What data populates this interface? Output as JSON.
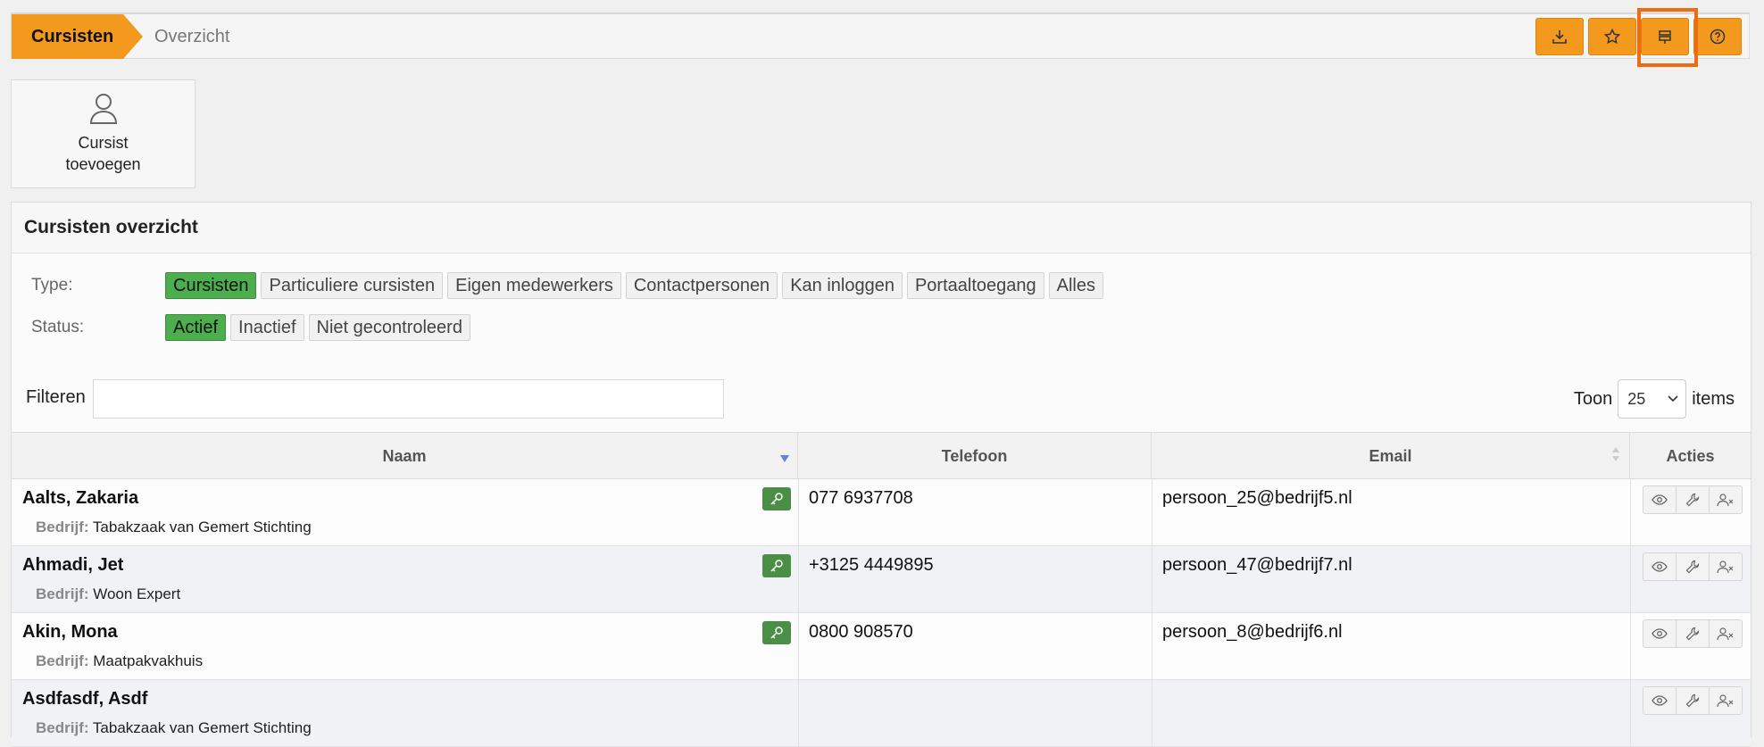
{
  "breadcrumb": {
    "main": "Cursisten",
    "sub": "Overzicht"
  },
  "toolbar": {
    "buttons": [
      "download-icon",
      "star-icon",
      "layout-icon",
      "help-icon"
    ],
    "accent": "#f39a1e",
    "highlight_color": "#f06a0f"
  },
  "add_button": {
    "line1": "Cursist",
    "line2": "toevoegen"
  },
  "panel": {
    "title": "Cursisten overzicht",
    "type_label": "Type:",
    "type_chips": [
      "Cursisten",
      "Particuliere cursisten",
      "Eigen medewerkers",
      "Contactpersonen",
      "Kan inloggen",
      "Portaaltoegang",
      "Alles"
    ],
    "status_label": "Status:",
    "status_chips": [
      "Actief",
      "Inactief",
      "Niet gecontroleerd"
    ],
    "filter_label": "Filteren",
    "filter_value": "",
    "show_label": "Toon",
    "show_value": "25",
    "items_label": "items"
  },
  "table": {
    "headers": {
      "name": "Naam",
      "phone": "Telefoon",
      "email": "Email",
      "actions": "Acties"
    },
    "company_label": "Bedrijf:",
    "rows": [
      {
        "name": "Aalts, Zakaria",
        "company": "Tabakzaak van Gemert Stichting",
        "phone": "077 6937708",
        "email": "persoon_25@bedrijf5.nl",
        "has_key": true
      },
      {
        "name": "Ahmadi, Jet",
        "company": "Woon Expert",
        "phone": "+3125 4449895",
        "email": "persoon_47@bedrijf7.nl",
        "has_key": true
      },
      {
        "name": "Akin, Mona",
        "company": "Maatpakvakhuis",
        "phone": "0800 908570",
        "email": "persoon_8@bedrijf6.nl",
        "has_key": true
      },
      {
        "name": "Asdfasdf, Asdf",
        "company": "Tabakzaak van Gemert Stichting",
        "phone": "",
        "email": "",
        "has_key": false
      }
    ]
  }
}
